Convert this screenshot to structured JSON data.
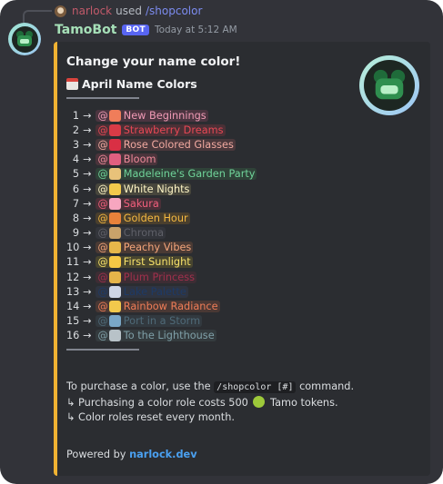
{
  "reply": {
    "user": "narlock",
    "used_text": "used",
    "command": "/shopcolor"
  },
  "header": {
    "bot_name": "TamoBot",
    "badge": "BOT",
    "timestamp": "Today at 5:12 AM"
  },
  "embed": {
    "accent_color": "#f0b232",
    "title": "Change your name color!",
    "section_title": "April Name Colors",
    "colors": [
      {
        "num": "1",
        "name": "New Beginnings",
        "text_color": "#f19bb6",
        "bg": "#4b3540",
        "emoji": "sunrise",
        "emoji_color": "#f07d5a"
      },
      {
        "num": "2",
        "name": "Strawberry Dreams",
        "text_color": "#e84855",
        "bg": "#4a3036",
        "emoji": "strawberry",
        "emoji_color": "#d93b46"
      },
      {
        "num": "3",
        "name": "Rose Colored Glasses",
        "text_color": "#f1a9a0",
        "bg": "#4a383c",
        "emoji": "rose",
        "emoji_color": "#d92f44"
      },
      {
        "num": "4",
        "name": "Bloom",
        "text_color": "#f08a9b",
        "bg": "#4a343b",
        "emoji": "tulip",
        "emoji_color": "#e05f80"
      },
      {
        "num": "5",
        "name": "Madeleine's Garden Party",
        "text_color": "#70d49a",
        "bg": "#2f4238",
        "emoji": "cupcake",
        "emoji_color": "#e8c27a"
      },
      {
        "num": "6",
        "name": "White Nights",
        "text_color": "#fff6c6",
        "bg": "#47463c",
        "emoji": "moon",
        "emoji_color": "#f2c94c"
      },
      {
        "num": "7",
        "name": "Sakura",
        "text_color": "#f25f7c",
        "bg": "#4a3038",
        "emoji": "blossom",
        "emoji_color": "#f7a6c0"
      },
      {
        "num": "8",
        "name": "Golden Hour",
        "text_color": "#f5b940",
        "bg": "#4a3f2d",
        "emoji": "sunset",
        "emoji_color": "#e8823a"
      },
      {
        "num": "9",
        "name": "Chroma",
        "text_color": "#5f6068",
        "bg": "#33353b",
        "emoji": "palette",
        "emoji_color": "#c9a26a"
      },
      {
        "num": "10",
        "name": "Peachy Vibes",
        "text_color": "#f5a57a",
        "bg": "#4a3a34",
        "emoji": "trophy",
        "emoji_color": "#e6b74a"
      },
      {
        "num": "11",
        "name": "First Sunlight",
        "text_color": "#f7e26a",
        "bg": "#48452f",
        "emoji": "sun-cloud",
        "emoji_color": "#f6c845"
      },
      {
        "num": "12",
        "name": "Plum Princess",
        "text_color": "#a0304c",
        "bg": "#3d2d34",
        "emoji": "princess",
        "emoji_color": "#e6b54a"
      },
      {
        "num": "13",
        "name": "Lake Palette",
        "text_color": "#1e3a66",
        "bg": "#2f3440",
        "emoji": "rain-cloud",
        "emoji_color": "#cfd6e6"
      },
      {
        "num": "14",
        "name": "Rainbow Radiance",
        "text_color": "#ef7d57",
        "bg": "#4a3834",
        "emoji": "search",
        "emoji_color": "#f2c94c"
      },
      {
        "num": "15",
        "name": "Port in a Storm",
        "text_color": "#4f6a78",
        "bg": "#32393f",
        "emoji": "anchor",
        "emoji_color": "#7aa7c7"
      },
      {
        "num": "16",
        "name": "To the Lighthouse",
        "text_color": "#7fa0a8",
        "bg": "#343b3e",
        "emoji": "compass",
        "emoji_color": "#b8c2c8"
      }
    ],
    "purchase_prefix": "To purchase a color, use the",
    "purchase_command": "/shopcolor [#]",
    "purchase_suffix": "command.",
    "cost_prefix": "↳ Purchasing a color role costs 500",
    "cost_suffix": "Tamo tokens.",
    "reset_text": "↳ Color roles reset every month.",
    "powered_prefix": "Powered by",
    "powered_link": "narlock.dev"
  }
}
